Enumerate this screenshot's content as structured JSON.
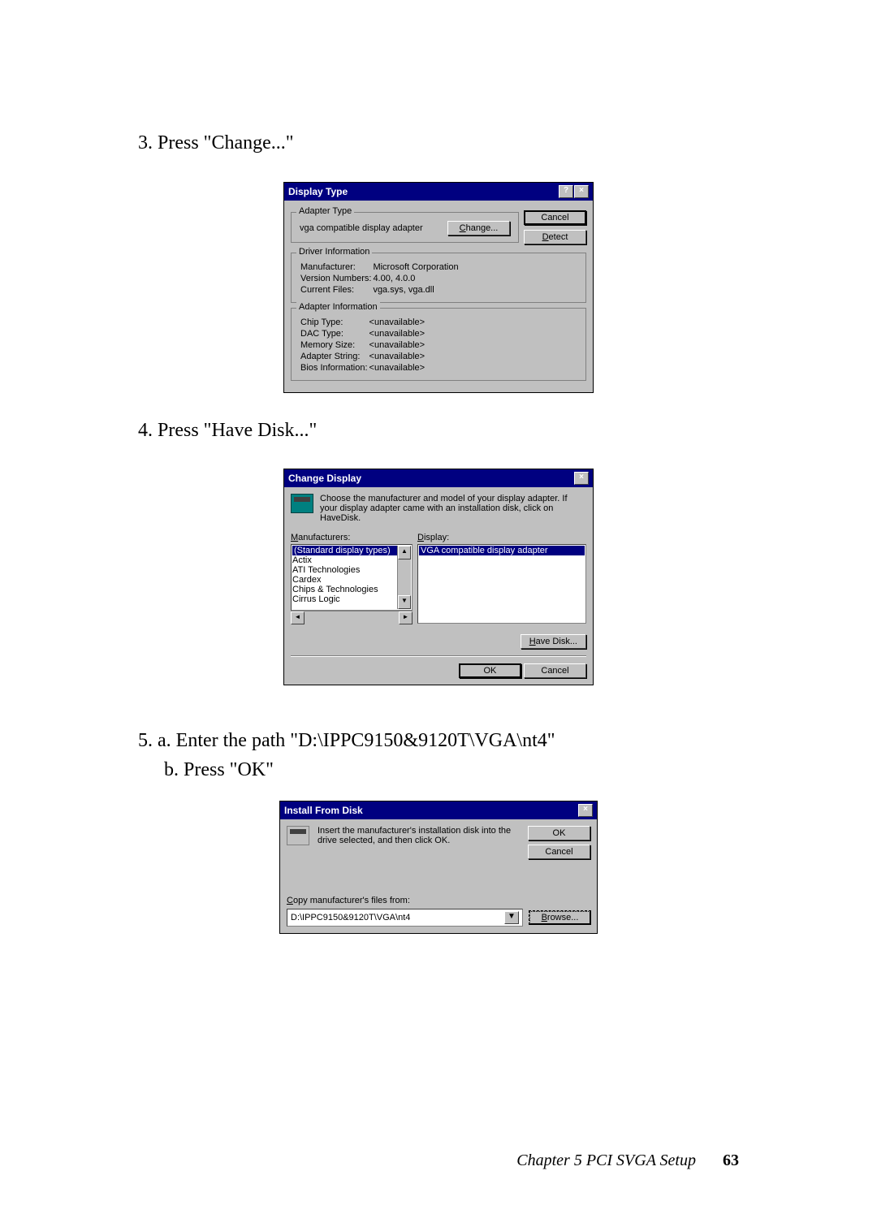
{
  "steps": {
    "s3": "3. Press \"Change...\"",
    "s4": "4. Press \"Have Disk...\"",
    "s5a": "5. a.  Enter the path \"D:\\IPPC9150&9120T\\VGA\\nt4\"",
    "s5b": "b. Press \"OK\""
  },
  "dlg1": {
    "title": "Display Type",
    "groups": {
      "adapter_type": {
        "legend": "Adapter Type",
        "text": "vga compatible display adapter",
        "change_btn": "Change..."
      },
      "driver_info": {
        "legend": "Driver Information",
        "rows": [
          {
            "label": "Manufacturer:",
            "value": "Microsoft Corporation"
          },
          {
            "label": "Version Numbers:",
            "value": "4.00, 4.0.0"
          },
          {
            "label": "Current Files:",
            "value": "vga.sys, vga.dll"
          }
        ]
      },
      "adapter_info": {
        "legend": "Adapter Information",
        "rows": [
          {
            "label": "Chip Type:",
            "value": "<unavailable>"
          },
          {
            "label": "DAC Type:",
            "value": "<unavailable>"
          },
          {
            "label": "Memory Size:",
            "value": "<unavailable>"
          },
          {
            "label": "Adapter String:",
            "value": "<unavailable>"
          },
          {
            "label": "Bios Information:",
            "value": "<unavailable>"
          }
        ]
      }
    },
    "cancel_btn": "Cancel",
    "detect_btn": "Detect"
  },
  "dlg2": {
    "title": "Change Display",
    "desc": "Choose the manufacturer and model of your display adapter.  If your display adapter came with an installation disk, click on HaveDisk.",
    "manufacturers_label": "Manufacturers:",
    "display_label": "Display:",
    "mfgs": [
      "(Standard display types)",
      "Actix",
      "ATI Technologies",
      "Cardex",
      "Chips & Technologies",
      "Cirrus Logic"
    ],
    "displays": [
      "VGA compatible display adapter"
    ],
    "have_disk_btn": "Have Disk...",
    "ok_btn": "OK",
    "cancel_btn": "Cancel"
  },
  "dlg3": {
    "title": "Install From Disk",
    "desc": "Insert the manufacturer's installation disk into the drive selected, and then click OK.",
    "copy_label": "Copy manufacturer's files from:",
    "path": "D:\\IPPC9150&9120T\\VGA\\nt4",
    "ok_btn": "OK",
    "cancel_btn": "Cancel",
    "browse_btn": "Browse..."
  },
  "footer": {
    "chapter": "Chapter 5  PCI SVGA Setup",
    "page": "63"
  },
  "icons": {
    "help": "?",
    "close": "×",
    "down": "▼",
    "left": "◄",
    "right": "►",
    "up": "▲"
  }
}
